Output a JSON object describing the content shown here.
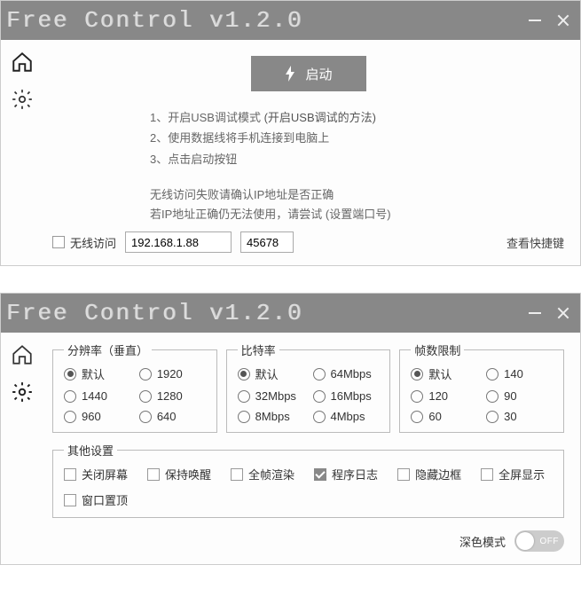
{
  "window1": {
    "title": "Free Control v1.2.0",
    "start_label": "启动",
    "instructions": [
      "1、开启USB调试模式",
      "2、使用数据线将手机连接到电脑上",
      "3、点击启动按钮"
    ],
    "usb_method_link": "(开启USB调试的方法)",
    "wireless_hint1": "无线访问失败请确认IP地址是否正确",
    "wireless_hint2": "若IP地址正确仍无法使用，请尝试",
    "port_link": "(设置端口号)",
    "wireless_checkbox": "无线访问",
    "ip_value": "192.168.1.88",
    "port_value": "45678",
    "view_shortcut": "查看快捷键"
  },
  "window2": {
    "title": "Free Control v1.2.0",
    "resolution": {
      "legend": "分辨率（垂直）",
      "options": [
        "默认",
        "1920",
        "1440",
        "1280",
        "960",
        "640"
      ],
      "selected": "默认"
    },
    "bitrate": {
      "legend": "比特率",
      "options": [
        "默认",
        "64Mbps",
        "32Mbps",
        "16Mbps",
        "8Mbps",
        "4Mbps"
      ],
      "selected": "默认"
    },
    "framerate": {
      "legend": "帧数限制",
      "options": [
        "默认",
        "140",
        "120",
        "90",
        "60",
        "30"
      ],
      "selected": "默认"
    },
    "other": {
      "legend": "其他设置",
      "items": [
        {
          "label": "关闭屏幕",
          "checked": false
        },
        {
          "label": "保持唤醒",
          "checked": false
        },
        {
          "label": "全帧渲染",
          "checked": false
        },
        {
          "label": "程序日志",
          "checked": true
        },
        {
          "label": "隐藏边框",
          "checked": false
        },
        {
          "label": "全屏显示",
          "checked": false
        },
        {
          "label": "窗口置顶",
          "checked": false
        }
      ]
    },
    "dark_mode_label": "深色模式",
    "dark_mode_state": "OFF"
  }
}
